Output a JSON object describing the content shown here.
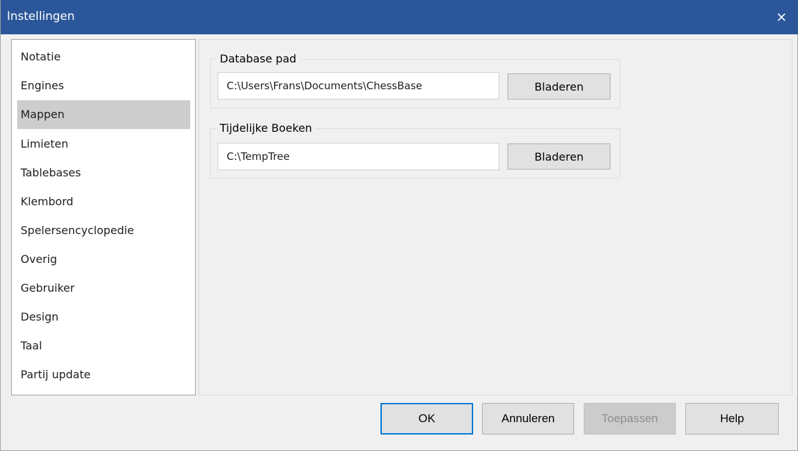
{
  "window": {
    "title": "Instellingen",
    "close_icon": "close-icon",
    "accent_color": "#2b579a"
  },
  "sidebar": {
    "items": [
      {
        "label": "Notatie"
      },
      {
        "label": "Engines"
      },
      {
        "label": "Mappen"
      },
      {
        "label": "Limieten"
      },
      {
        "label": "Tablebases"
      },
      {
        "label": "Klembord"
      },
      {
        "label": "Spelersencyclopedie"
      },
      {
        "label": "Overig"
      },
      {
        "label": "Gebruiker"
      },
      {
        "label": "Design"
      },
      {
        "label": "Taal"
      },
      {
        "label": "Partij update"
      }
    ],
    "selected": "Mappen"
  },
  "main": {
    "groups": [
      {
        "legend": "Database pad",
        "path_value": "C:\\Users\\Frans\\Documents\\ChessBase",
        "browse_label": "Bladeren"
      },
      {
        "legend": "Tijdelijke Boeken",
        "path_value": "C:\\TempTree",
        "browse_label": "Bladeren"
      }
    ]
  },
  "footer": {
    "ok_label": "OK",
    "cancel_label": "Annuleren",
    "apply_label": "Toepassen",
    "help_label": "Help"
  }
}
